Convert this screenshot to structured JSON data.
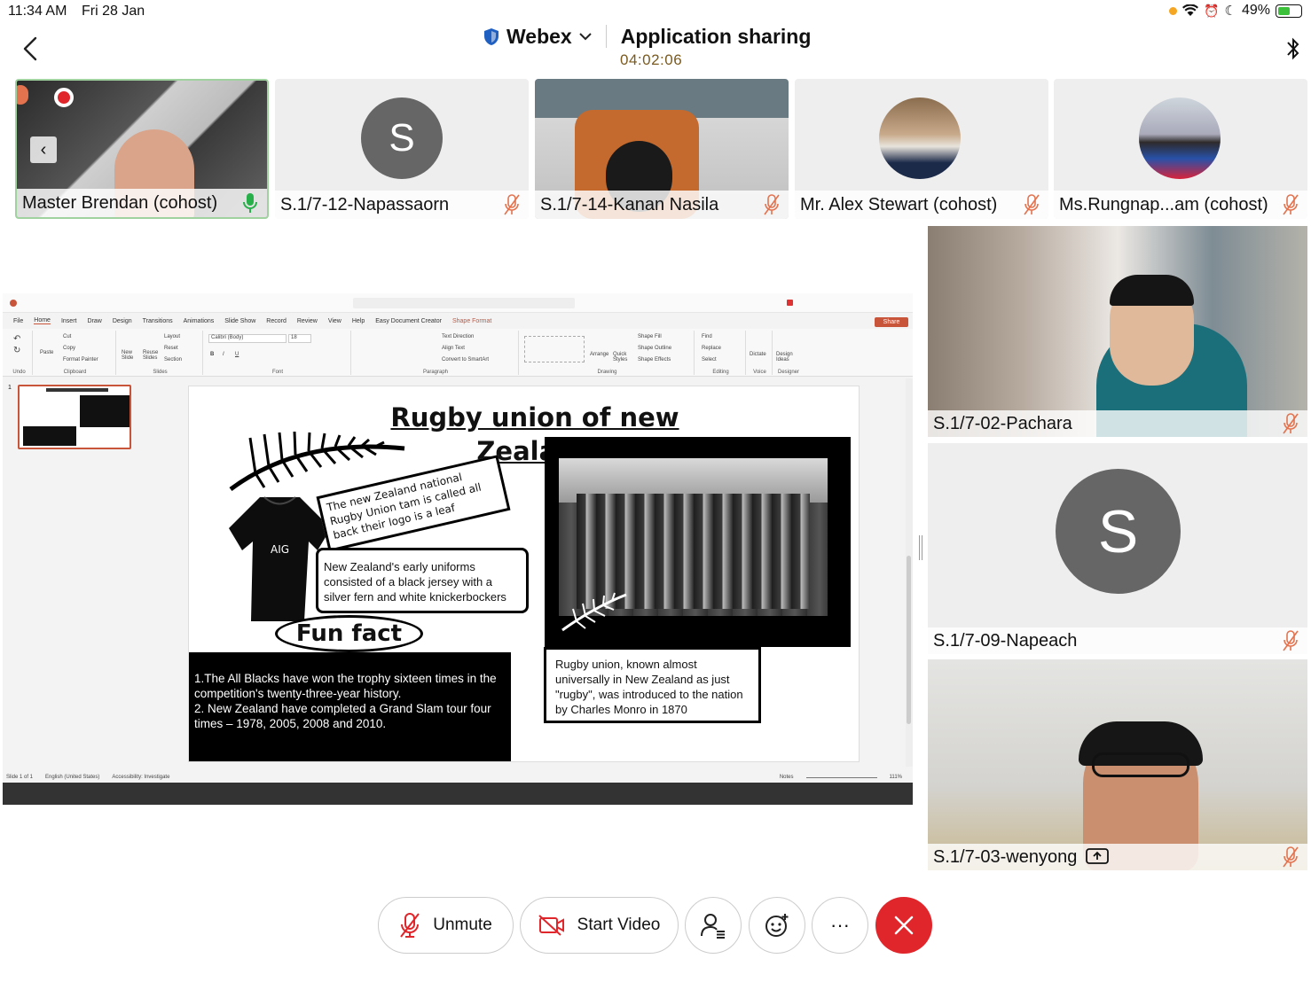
{
  "status": {
    "time": "11:34 AM",
    "date": "Fri 28 Jan",
    "battery": "49%"
  },
  "header": {
    "brand": "Webex",
    "app_title": "Application sharing",
    "timer": "04:02:06"
  },
  "participants_top": [
    {
      "name": "Master Brendan (cohost)",
      "video": true,
      "mic": "active"
    },
    {
      "name": "S.1/7-12-Napassaorn",
      "avatar": "S",
      "mic": "muted"
    },
    {
      "name": "S.1/7-14-Kanan Nasila",
      "video": true,
      "mic": "muted"
    },
    {
      "name": "Mr. Alex Stewart (cohost)",
      "photo": true,
      "mic": "muted"
    },
    {
      "name": "Ms.Rungnap...am (cohost)",
      "photo": true,
      "mic": "muted"
    }
  ],
  "participants_side": [
    {
      "name": "S.1/7-02-Pachara",
      "video": true,
      "mic": "muted"
    },
    {
      "name": "S.1/7-09-Napeach",
      "avatar": "S",
      "mic": "muted"
    },
    {
      "name": "S.1/7-03-wenyong",
      "video": true,
      "mic": "muted",
      "sharing": true
    }
  ],
  "ppt": {
    "menu": [
      "File",
      "Home",
      "Insert",
      "Draw",
      "Design",
      "Transitions",
      "Animations",
      "Slide Show",
      "Record",
      "Review",
      "View",
      "Help",
      "Easy Document Creator",
      "Shape Format"
    ],
    "share_label": "Share",
    "groups": [
      "Undo",
      "Clipboard",
      "Slides",
      "Font",
      "Paragraph",
      "Drawing",
      "Editing",
      "Voice",
      "Designer"
    ],
    "ribbon_items": {
      "cut": "Cut",
      "copy": "Copy",
      "format_painter": "Format Painter",
      "paste": "Paste",
      "new_slide": "New Slide",
      "reuse_slides": "Reuse Slides",
      "layout": "Layout",
      "reset": "Reset",
      "section": "Section",
      "font": "Calibri (Body)",
      "size": "18",
      "text_direction": "Text Direction",
      "align_text": "Align Text",
      "smartart": "Convert to SmartArt",
      "arrange": "Arrange",
      "quick_styles": "Quick Styles",
      "shape_fill": "Shape Fill",
      "shape_outline": "Shape Outline",
      "shape_effects": "Shape Effects",
      "find": "Find",
      "replace": "Replace",
      "select": "Select",
      "dictate": "Dictate",
      "design_ideas": "Design Ideas"
    },
    "status": {
      "slide": "Slide 1 of 1",
      "language": "English (United States)",
      "accessibility": "Accessibility: Investigate",
      "notes": "Notes",
      "zoom": "111%"
    },
    "thumb_number": "1"
  },
  "slide": {
    "title": "Rugby union of new Zealand",
    "leaf_text": "The new Zealand national Rugby Union tam is called all back their logo is a leaf",
    "uniform_text": "New Zealand's early uniforms consisted of a black jersey with a silver fern and white knickerbockers",
    "fun_fact_label": "Fun fact",
    "facts": "1.The All Blacks have won the trophy sixteen times in the competition's twenty-three-year history.\n2. New Zealand have completed a Grand Slam tour four times – 1978, 2005, 2008 and 2010.",
    "rugby_text": "Rugby union, known almost universally in New Zealand as just \"rugby\", was introduced to the nation by Charles Monro in 1870"
  },
  "controls": {
    "unmute": "Unmute",
    "start_video": "Start Video",
    "more": "···"
  },
  "colors": {
    "end_call": "#e0252b",
    "accent": "#1a73e8",
    "mic_active": "#27b04a",
    "mic_muted": "#e3734f"
  }
}
